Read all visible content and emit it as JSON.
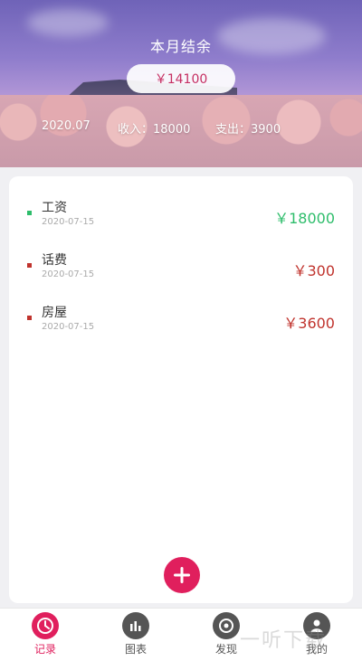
{
  "header": {
    "title": "本月结余",
    "balance": "￥14100",
    "month": "2020.07",
    "income": "收入：18000",
    "expense": "支出：3900"
  },
  "records": [
    {
      "name": "工资",
      "date": "2020-07-15",
      "amount": "￥18000",
      "color": "#2ebd6b"
    },
    {
      "name": "话费",
      "date": "2020-07-15",
      "amount": "￥300",
      "color": "#c0332d"
    },
    {
      "name": "房屋",
      "date": "2020-07-15",
      "amount": "￥3600",
      "color": "#c0332d"
    }
  ],
  "tabs": [
    {
      "label": "记录",
      "icon": "clock-icon",
      "active": true
    },
    {
      "label": "图表",
      "icon": "chart-icon",
      "active": false
    },
    {
      "label": "发现",
      "icon": "discover-icon",
      "active": false
    },
    {
      "label": "我的",
      "icon": "user-icon",
      "active": false
    }
  ],
  "colors": {
    "accent": "#e01f5d",
    "income": "#2ebd6b",
    "expense": "#c0332d"
  },
  "watermark": "一听下载"
}
